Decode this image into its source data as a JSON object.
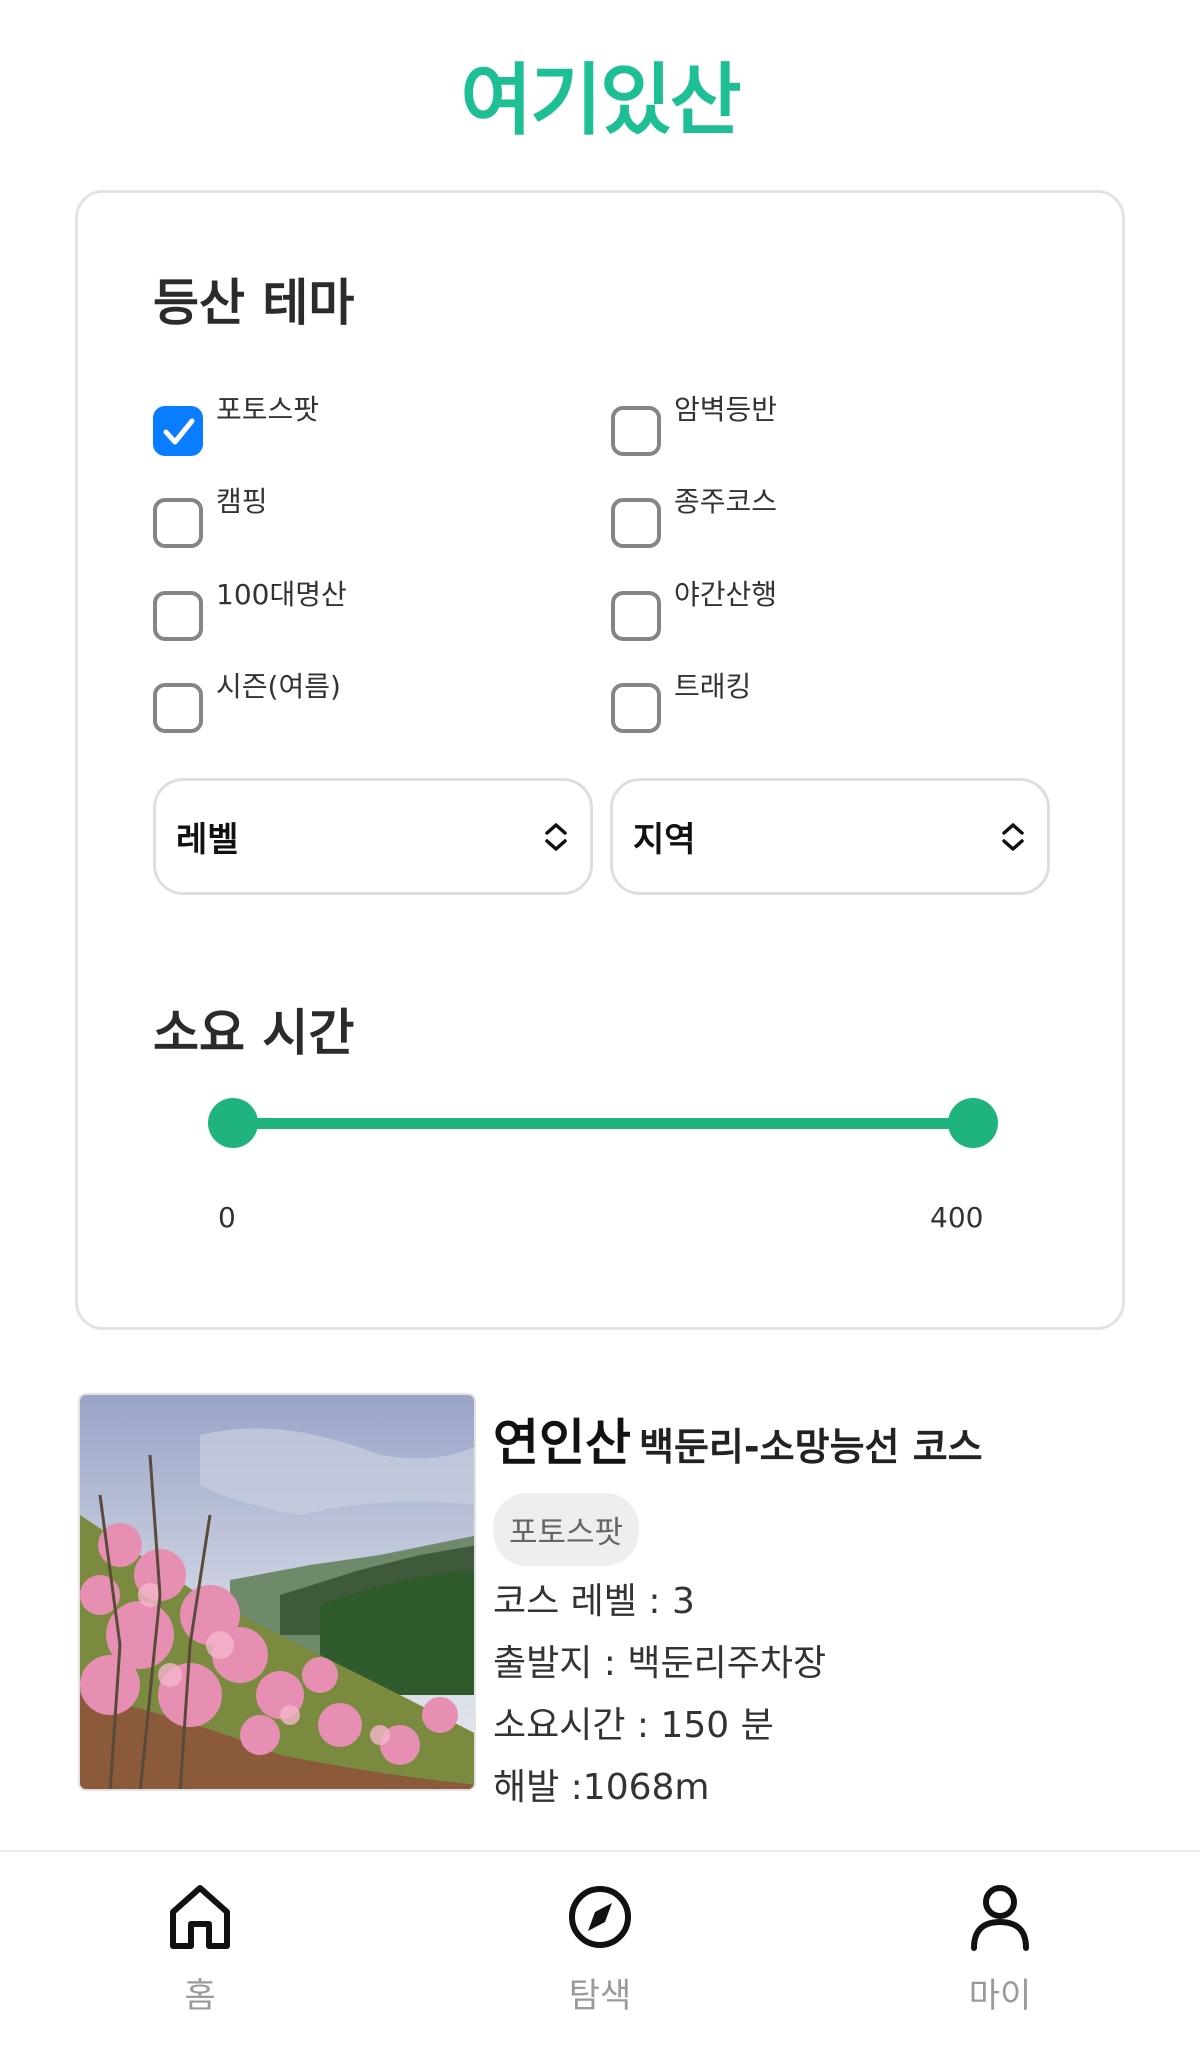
{
  "app": {
    "logo": "여기있산",
    "brand_color": "#1fbf95"
  },
  "filters": {
    "theme_title": "등산 테마",
    "themes": [
      {
        "label": "포토스팟",
        "checked": true
      },
      {
        "label": "암벽등반",
        "checked": false
      },
      {
        "label": "캠핑",
        "checked": false
      },
      {
        "label": "종주코스",
        "checked": false
      },
      {
        "label": "100대명산",
        "checked": false
      },
      {
        "label": "야간산행",
        "checked": false
      },
      {
        "label": "시즌(여름)",
        "checked": false
      },
      {
        "label": "트래킹",
        "checked": false
      }
    ],
    "level_select": {
      "label": "레벨"
    },
    "region_select": {
      "label": "지역"
    },
    "time_title": "소요 시간",
    "time_range": {
      "min": "0",
      "max": "400",
      "slider_color": "#1fb47e"
    }
  },
  "course": {
    "mountain": "연인산",
    "route": "백둔리-소망능선 코스",
    "tag": "포토스팟",
    "level": "코스 레벨 : 3",
    "start": "출발지 : 백둔리주차장",
    "duration": "소요시간 : 150 분",
    "altitude": "해발 :1068m"
  },
  "nav": {
    "items": [
      {
        "label": "홈",
        "icon": "home-icon"
      },
      {
        "label": "탐색",
        "icon": "compass-icon"
      },
      {
        "label": "마이",
        "icon": "user-icon"
      }
    ]
  }
}
